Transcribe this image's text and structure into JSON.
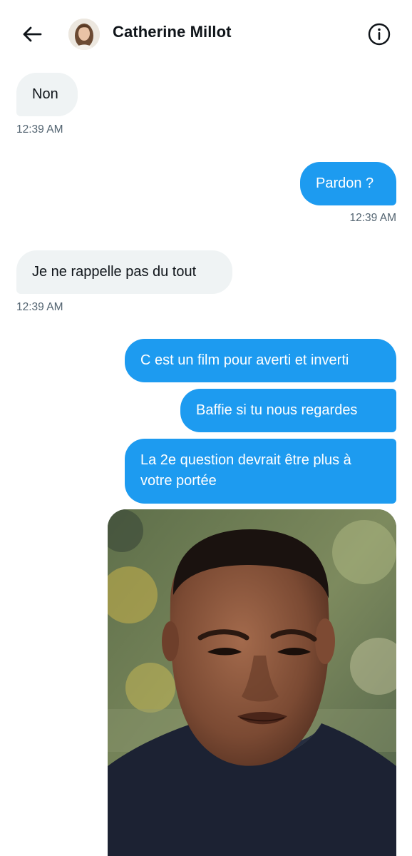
{
  "header": {
    "contact_name": "Catherine Millot"
  },
  "messages": [
    {
      "direction": "in",
      "text": "Non",
      "time": "12:39 AM"
    },
    {
      "direction": "out",
      "text": "Pardon ?",
      "time": "12:39 AM"
    },
    {
      "direction": "in",
      "text": "Je ne rappelle pas du tout",
      "time": "12:39 AM"
    },
    {
      "direction": "out",
      "text": "C est un film pour averti et inverti"
    },
    {
      "direction": "out",
      "text": "Baffie si tu nous regardes"
    },
    {
      "direction": "out",
      "text": "La 2e question devrait être plus à votre portée"
    }
  ],
  "colors": {
    "sent_bubble": "#1d9bf0",
    "received_bubble": "#eff3f4",
    "timestamp": "#536471"
  },
  "icons": {
    "back": "arrow-left-icon",
    "info": "info-circle-icon"
  }
}
